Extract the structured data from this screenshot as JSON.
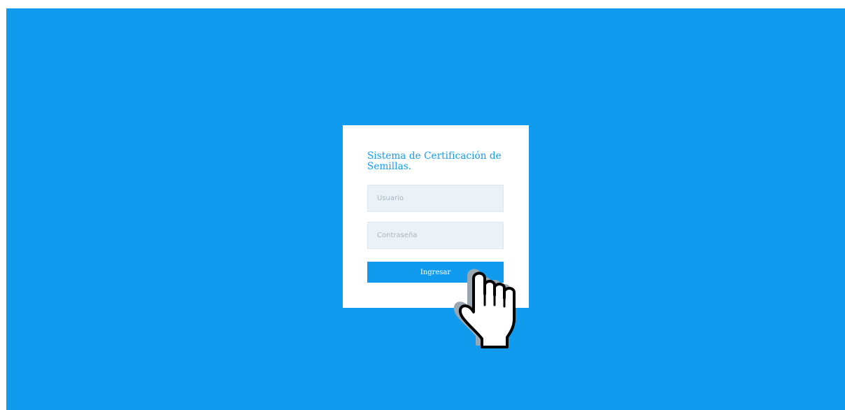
{
  "login": {
    "title": "Sistema de Certificación de Semillas.",
    "username_placeholder": "Usuario",
    "password_placeholder": "Contraseña",
    "submit_label": "Ingresar"
  },
  "colors": {
    "background": "#119bef",
    "card": "#ffffff",
    "accent": "#119bef",
    "input_bg": "#ebf2f7"
  },
  "cursor": {
    "icon": "hand-pointer-icon"
  }
}
